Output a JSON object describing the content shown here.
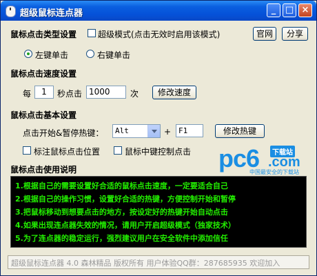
{
  "window": {
    "title": "超级鼠标连点器",
    "controls": {
      "minimize": "_",
      "maximize": "□",
      "close": "×"
    }
  },
  "click_type": {
    "heading": "鼠标点击类型设置",
    "super_mode_label": "超级模式(点击无效时启用该模式)",
    "super_mode_checked": false,
    "website_button": "官网",
    "share_button": "分享",
    "left_click_label": "左键单击",
    "right_click_label": "右键单击",
    "selected": "left"
  },
  "speed": {
    "heading": "鼠标点击速度设置",
    "per_label": "每",
    "seconds_value": "1",
    "seconds_click_label": "秒点击",
    "count_value": "1000",
    "times_label": "次",
    "modify_button": "修改速度"
  },
  "basic": {
    "heading": "鼠标点击基本设置",
    "hotkey_label": "点击开始&暂停热键：",
    "modifier_value": "Alt",
    "plus": "+",
    "key_value": "F1",
    "modify_hotkey_button": "修改热键",
    "mark_position_label": "标注鼠标点击位置",
    "mark_position_checked": false,
    "middle_click_label": "鼠标中键控制点击",
    "middle_click_checked": false
  },
  "logo": {
    "brand": "pc6",
    "badge": "下载站",
    "domain": ".com",
    "tagline": "中国最安全的下载站"
  },
  "instructions": {
    "heading": "鼠标点击使用说明",
    "lines": [
      "1.根据自己的需要设置好合适的鼠标点击速度，一定要适合自己",
      "2.根据自己的操作习惯，设置好合适的热键，方便控制开始和暂停",
      "3.把鼠标移动到想要点击的地方，按设定好的热键开始自动点击",
      "4.如果出现连点器失效的情况，请用户开启超级模式（独家技术）",
      "5.为了连点器的稳定运行，强烈建议用户在安全软件中添加信任"
    ]
  },
  "status_bar": {
    "text": "超级鼠标连点器 4.0  森林精品 版权所有 用户体验QQ群：287685935 欢迎加入"
  }
}
